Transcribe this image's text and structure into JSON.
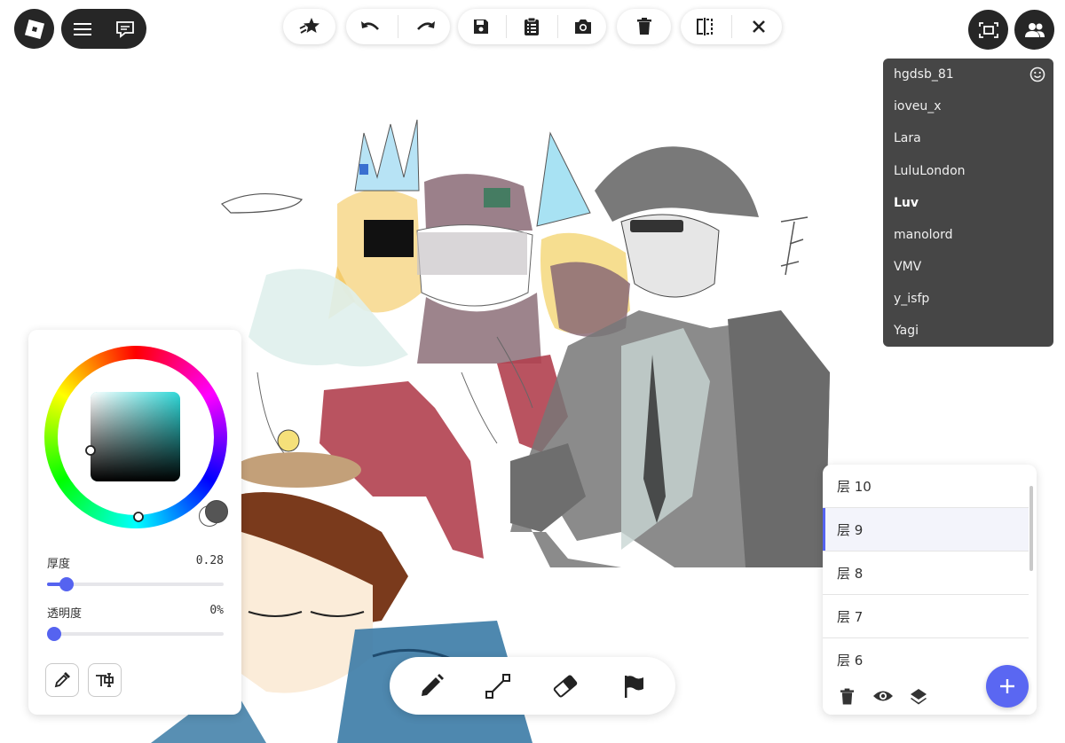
{
  "toolbar": {
    "buttons": [
      "effects",
      "undo",
      "redo",
      "save",
      "clipboard",
      "snapshot",
      "delete",
      "mirror",
      "close"
    ]
  },
  "players": {
    "items": [
      {
        "name": "hgdsb_81",
        "bold": false
      },
      {
        "name": "ioveu_x",
        "bold": false
      },
      {
        "name": "Lara",
        "bold": false
      },
      {
        "name": "LuluLondon",
        "bold": false
      },
      {
        "name": "Luv",
        "bold": true
      },
      {
        "name": "manolord",
        "bold": false
      },
      {
        "name": "VMV",
        "bold": false
      },
      {
        "name": "y_isfp",
        "bold": false
      },
      {
        "name": "Yagi",
        "bold": false
      }
    ]
  },
  "brush": {
    "thickness_label": "厚度",
    "thickness_value": "0.28",
    "thickness_fraction": 0.11,
    "opacity_label": "透明度",
    "opacity_value": "0%",
    "opacity_fraction": 0.0,
    "hue_color": "#2fd8d8",
    "current_color": "#555555"
  },
  "layers": {
    "items": [
      {
        "label": "层 10",
        "selected": false
      },
      {
        "label": "层 9",
        "selected": true
      },
      {
        "label": "层 8",
        "selected": false
      },
      {
        "label": "层 7",
        "selected": false
      },
      {
        "label": "层 6",
        "selected": false
      }
    ]
  },
  "colors": {
    "accent": "#5563f0",
    "dark": "#262626",
    "player_bg": "#464646"
  }
}
